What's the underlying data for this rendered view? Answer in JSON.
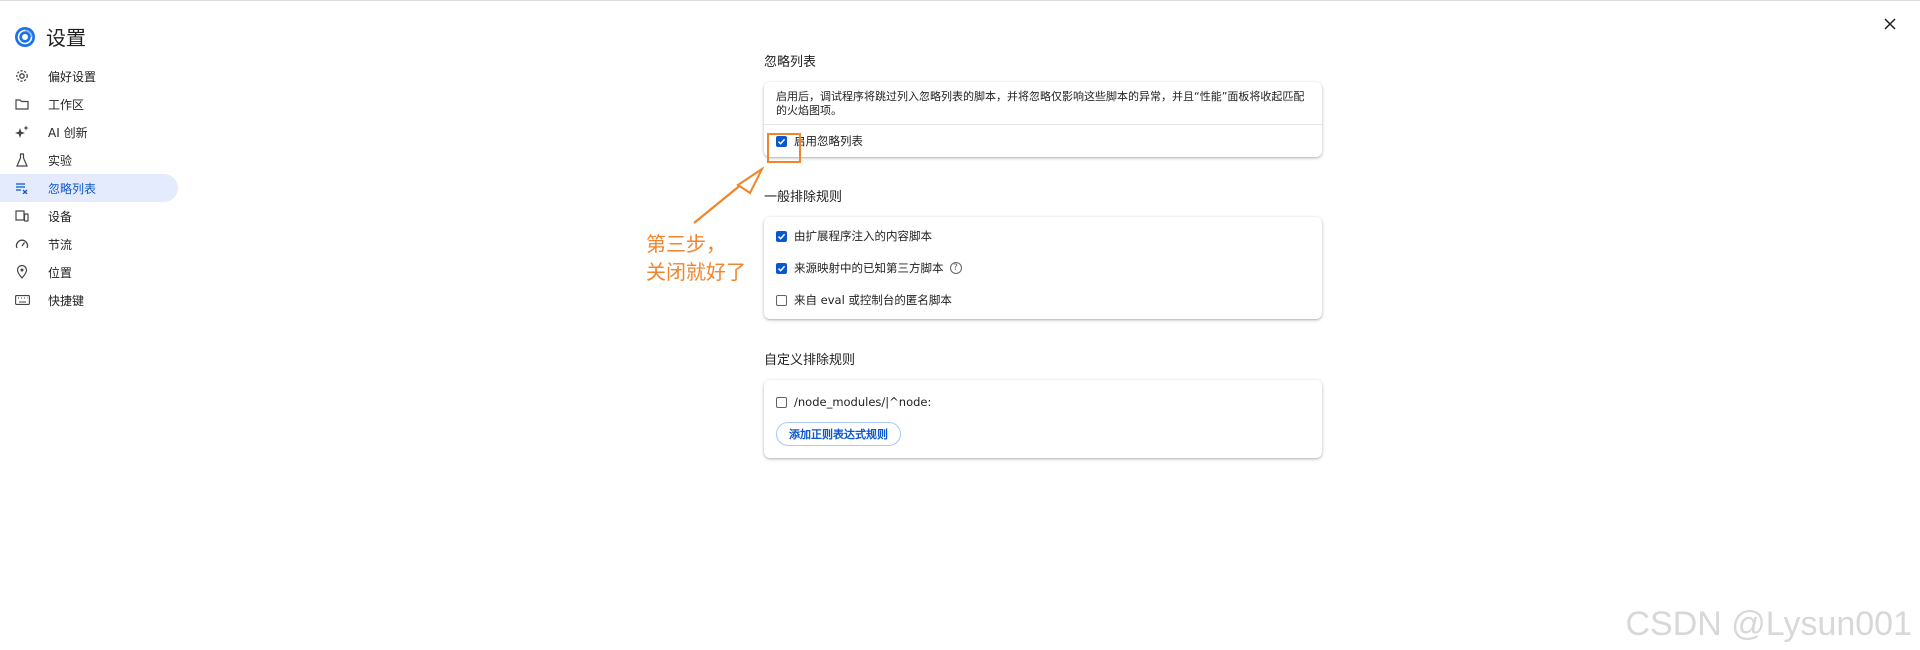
{
  "app": {
    "title": "设置"
  },
  "sidebar": {
    "items": [
      {
        "label": "偏好设置",
        "icon": "gear-icon"
      },
      {
        "label": "工作区",
        "icon": "folder-icon"
      },
      {
        "label": "AI 创新",
        "icon": "sparkle-icon"
      },
      {
        "label": "实验",
        "icon": "flask-icon"
      },
      {
        "label": "忽略列表",
        "icon": "ignore-list-icon",
        "active": true
      },
      {
        "label": "设备",
        "icon": "devices-icon"
      },
      {
        "label": "节流",
        "icon": "speedometer-icon"
      },
      {
        "label": "位置",
        "icon": "location-pin-icon"
      },
      {
        "label": "快捷键",
        "icon": "keyboard-icon"
      }
    ]
  },
  "ignore_list": {
    "title": "忽略列表",
    "description": "启用后，调试程序将跳过列入忽略列表的脚本，并将忽略仅影响这些脚本的异常，并且“性能”面板将收起匹配的火焰图项。",
    "enable_label": "启用忽略列表",
    "enable_checked": true
  },
  "general_rules": {
    "title": "一般排除规则",
    "items": [
      {
        "label": "由扩展程序注入的内容脚本",
        "checked": true
      },
      {
        "label": "来源映射中的已知第三方脚本",
        "checked": true,
        "help": "?"
      },
      {
        "label": "来自 eval 或控制台的匿名脚本",
        "checked": false
      }
    ]
  },
  "custom_rules": {
    "title": "自定义排除规则",
    "items": [
      {
        "label": "/node_modules/|^node:",
        "checked": false
      }
    ],
    "add_button": "添加正则表达式规则"
  },
  "annotation": {
    "line1": "第三步，",
    "line2": "关闭就好了",
    "color": "#f0862c"
  },
  "watermark": "CSDN @Lysun001",
  "colors": {
    "accent": "#0b57d0",
    "active_bg": "#e3ebfd"
  }
}
